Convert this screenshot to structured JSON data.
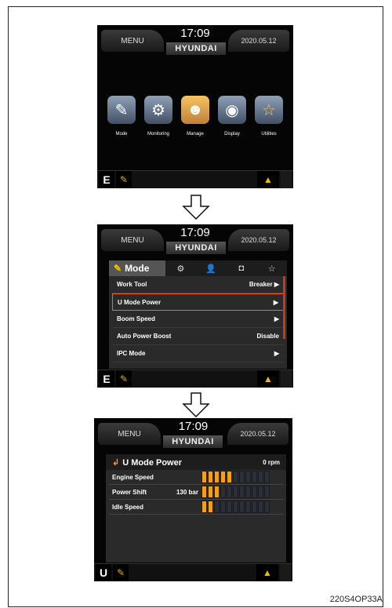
{
  "screens": [
    {
      "menu": "MENU",
      "time": "17:09",
      "brand": "HYUNDAI",
      "date": "2020.05.12",
      "footer_mode": "E"
    },
    {
      "menu": "MENU",
      "time": "17:09",
      "brand": "HYUNDAI",
      "date": "2020.05.12",
      "footer_mode": "E"
    },
    {
      "menu": "MENU",
      "time": "17:09",
      "brand": "HYUNDAI",
      "date": "2020.05.12",
      "footer_mode": "U"
    }
  ],
  "main_menu": {
    "items": [
      {
        "label": "Mode",
        "icon": "pencil-icon"
      },
      {
        "label": "Monitoring",
        "icon": "gauge-icon"
      },
      {
        "label": "Manage",
        "icon": "person-icon"
      },
      {
        "label": "Display",
        "icon": "display-icon"
      },
      {
        "label": "Utilities",
        "icon": "star-icon"
      }
    ]
  },
  "mode_panel": {
    "title": "Mode",
    "rows": [
      {
        "label": "Work Tool",
        "value": "Breaker ▶"
      },
      {
        "label": "U Mode Power",
        "value": "▶"
      },
      {
        "label": "Boom Speed",
        "value": "▶"
      },
      {
        "label": "Auto Power Boost",
        "value": "Disable"
      },
      {
        "label": "IPC Mode",
        "value": "▶"
      }
    ]
  },
  "umode_panel": {
    "title": "U Mode Power",
    "rpm": "0 rpm",
    "rows": [
      {
        "label": "Engine Speed",
        "value": "",
        "level": 5,
        "max": 11
      },
      {
        "label": "Power Shift",
        "value": "130 bar",
        "level": 3,
        "max": 11
      },
      {
        "label": "Idle Speed",
        "value": "",
        "level": 2,
        "max": 11
      }
    ]
  },
  "caption": "220S4OP33A",
  "colors": {
    "accent": "#f2a20c",
    "selection": "#ff6a00"
  }
}
